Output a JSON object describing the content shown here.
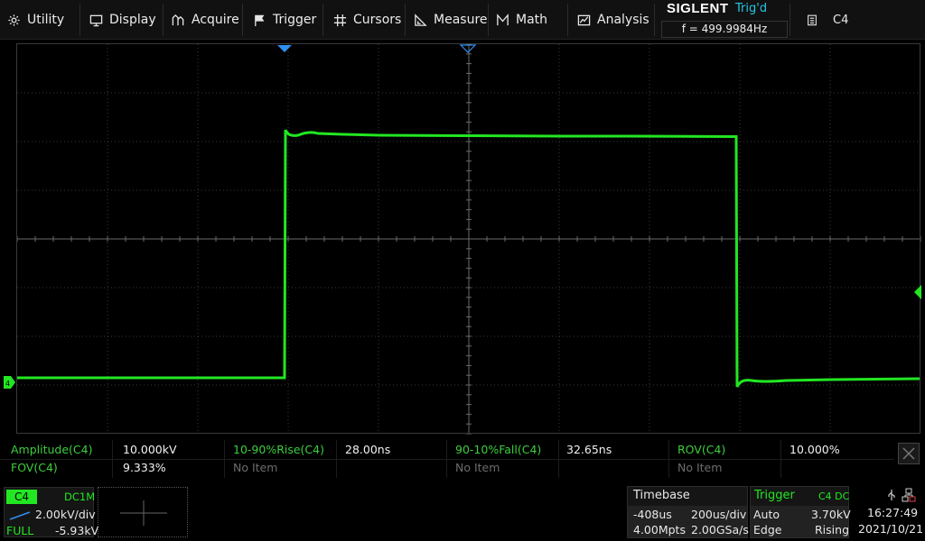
{
  "menu": {
    "utility": "Utility",
    "display": "Display",
    "acquire": "Acquire",
    "trigger": "Trigger",
    "cursors": "Cursors",
    "measure": "Measure",
    "math": "Math",
    "analysis": "Analysis"
  },
  "brand": "SIGLENT",
  "trigger_status": "Trig'd",
  "frequency": "f = 499.9984Hz",
  "source": "C4",
  "measurements": [
    {
      "label": "Amplitude(C4)",
      "value": "10.000kV"
    },
    {
      "label": "10-90%Rise(C4)",
      "value": "28.00ns"
    },
    {
      "label": "90-10%Fall(C4)",
      "value": "32.65ns"
    },
    {
      "label": "ROV(C4)",
      "value": "10.000%"
    },
    {
      "label": "FOV(C4)",
      "value": "9.333%"
    },
    {
      "label": "No Item",
      "value": ""
    },
    {
      "label": "No Item",
      "value": ""
    },
    {
      "label": "No Item",
      "value": ""
    }
  ],
  "channel": {
    "name": "C4",
    "coupling": "DC1M",
    "scale": "2.00kV/div",
    "bandwidth": "FULL",
    "offset": "-5.93kV"
  },
  "timebase": {
    "title": "Timebase",
    "delay": "-408us",
    "scale": "200us/div",
    "memory": "4.00Mpts",
    "sample_rate": "2.00GSa/s"
  },
  "trigger": {
    "title": "Trigger",
    "source": "C4 DC",
    "mode": "Auto",
    "level": "3.70kV",
    "type": "Edge",
    "slope": "Rising"
  },
  "clock": {
    "time": "16:27:49",
    "date": "2021/10/21"
  },
  "colors": {
    "channel4": "#22e622",
    "trigger_status": "#22c7e6",
    "label_green": "#3ccf3c",
    "marker_blue": "#2f8ff0"
  }
}
